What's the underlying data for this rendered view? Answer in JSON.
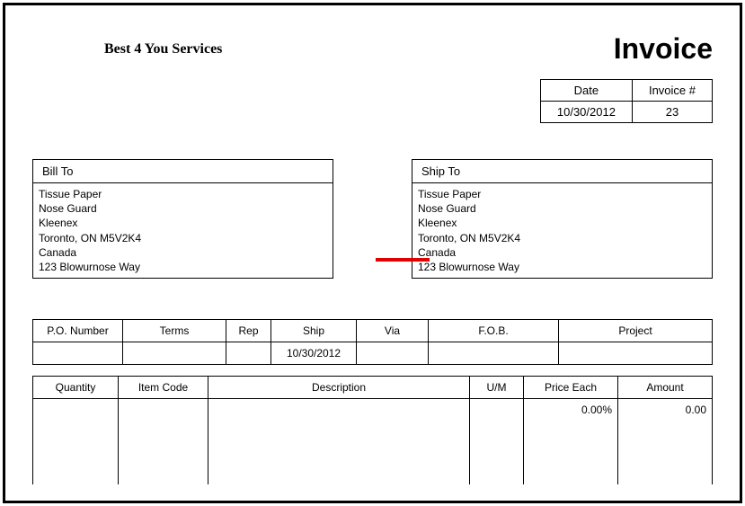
{
  "company_name": "Best 4 You Services",
  "title": "Invoice",
  "meta": {
    "date_label": "Date",
    "invoice_no_label": "Invoice #",
    "date": "10/30/2012",
    "invoice_no": "23"
  },
  "bill_to": {
    "label": "Bill To",
    "lines": [
      "Tissue Paper",
      "Nose Guard",
      "Kleenex",
      "Toronto, ON M5V2K4",
      "Canada",
      "123 Blowurnose Way"
    ]
  },
  "ship_to": {
    "label": "Ship To",
    "lines": [
      "Tissue Paper",
      "Nose Guard",
      "Kleenex",
      "Toronto, ON M5V2K4",
      "Canada",
      "123 Blowurnose Way"
    ]
  },
  "order": {
    "headers": {
      "po_number": "P.O. Number",
      "terms": "Terms",
      "rep": "Rep",
      "ship": "Ship",
      "via": "Via",
      "fob": "F.O.B.",
      "project": "Project"
    },
    "values": {
      "po_number": "",
      "terms": "",
      "rep": "",
      "ship": "10/30/2012",
      "via": "",
      "fob": "",
      "project": ""
    }
  },
  "items": {
    "headers": {
      "quantity": "Quantity",
      "item_code": "Item Code",
      "description": "Description",
      "um": "U/M",
      "price_each": "Price Each",
      "amount": "Amount"
    },
    "rows": [
      {
        "quantity": "",
        "item_code": "",
        "description": "",
        "um": "",
        "price_each": "0.00%",
        "amount": "0.00"
      }
    ]
  }
}
